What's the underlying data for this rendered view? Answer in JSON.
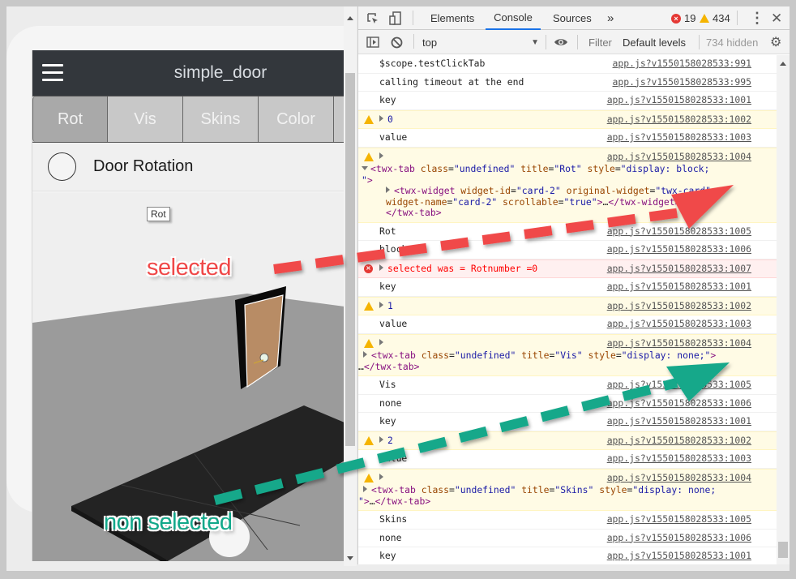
{
  "app": {
    "title": "simple_door",
    "menu_icon": "hamburger-menu-icon",
    "tabs": [
      {
        "label": "Rot",
        "active": true
      },
      {
        "label": "Vis",
        "active": false
      },
      {
        "label": "Skins",
        "active": false
      },
      {
        "label": "Color",
        "active": false
      }
    ],
    "card": {
      "label": "Door Rotation",
      "radio_checked": false
    },
    "tooltip": "Rot"
  },
  "annotations": {
    "selected": {
      "text": "selected",
      "color": "#f04848"
    },
    "non_selected": {
      "text": "non selected",
      "color": "#12a88a"
    }
  },
  "devtools": {
    "tabs": [
      {
        "label": "Elements",
        "active": false
      },
      {
        "label": "Console",
        "active": true
      },
      {
        "label": "Sources",
        "active": false
      }
    ],
    "more_tabs": "»",
    "error_count": "19",
    "warning_count": "434",
    "toolbar": {
      "context": "top",
      "filter_placeholder": "Filter",
      "levels": "Default levels",
      "hidden": "734 hidden"
    },
    "logs": [
      {
        "level": "log",
        "text": "$scope.testClickTab",
        "src": "app.js?v1550158028533:991"
      },
      {
        "level": "log",
        "text": "calling timeout at the end",
        "src": "app.js?v1550158028533:995"
      },
      {
        "level": "log",
        "text": "key",
        "src": "app.js?v1550158028533:1001"
      },
      {
        "level": "warn",
        "text": "0",
        "src": "app.js?v1550158028533:1002"
      },
      {
        "level": "log",
        "text": "value",
        "src": "app.js?v1550158028533:1003"
      },
      {
        "level": "warn",
        "src": "app.js?v1550158028533:1004",
        "node": {
          "tag": "twx-tab",
          "class": "undefined",
          "title": "Rot",
          "style": "display: block;",
          "child": {
            "tag": "twx-widget",
            "widget_id": "card-2",
            "original_widget": "twx-card",
            "widget_name": "card-2",
            "scrollable": "true"
          }
        }
      },
      {
        "level": "log",
        "text": "Rot",
        "src": "app.js?v1550158028533:1005"
      },
      {
        "level": "log",
        "text": "block",
        "src": "app.js?v1550158028533:1006"
      },
      {
        "level": "error",
        "text": "selected was = Rotnumber =0",
        "src": "app.js?v1550158028533:1007"
      },
      {
        "level": "log",
        "text": "key",
        "src": "app.js?v1550158028533:1001"
      },
      {
        "level": "warn",
        "text": "1",
        "src": "app.js?v1550158028533:1002"
      },
      {
        "level": "log",
        "text": "value",
        "src": "app.js?v1550158028533:1003"
      },
      {
        "level": "warn",
        "src": "app.js?v1550158028533:1004",
        "node": {
          "tag": "twx-tab",
          "class": "undefined",
          "title": "Vis",
          "style": "display: none;"
        }
      },
      {
        "level": "log",
        "text": "Vis",
        "src": "app.js?v1550158028533:1005"
      },
      {
        "level": "log",
        "text": "none",
        "src": "app.js?v1550158028533:1006"
      },
      {
        "level": "log",
        "text": "key",
        "src": "app.js?v1550158028533:1001"
      },
      {
        "level": "warn",
        "text": "2",
        "src": "app.js?v1550158028533:1002"
      },
      {
        "level": "log",
        "text": "value",
        "src": "app.js?v1550158028533:1003"
      },
      {
        "level": "warn",
        "src": "app.js?v1550158028533:1004",
        "node": {
          "tag": "twx-tab",
          "class": "undefined",
          "title": "Skins",
          "style": "display: none;"
        }
      },
      {
        "level": "log",
        "text": "Skins",
        "src": "app.js?v1550158028533:1005"
      },
      {
        "level": "log",
        "text": "none",
        "src": "app.js?v1550158028533:1006"
      },
      {
        "level": "log",
        "text": "key",
        "src": "app.js?v1550158028533:1001"
      }
    ]
  }
}
